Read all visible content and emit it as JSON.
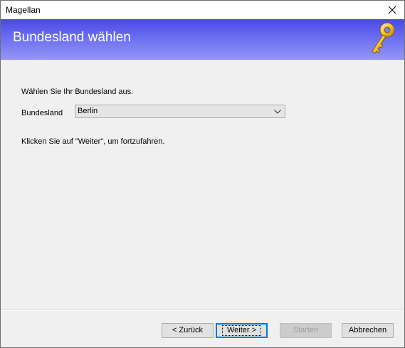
{
  "window": {
    "title": "Magellan"
  },
  "banner": {
    "heading": "Bundesland wählen",
    "icon": "key-icon"
  },
  "content": {
    "intro": "Wählen Sie Ihr Bundesland aus.",
    "field_label": "Bundesland",
    "selected_state": "Berlin",
    "hint": "Klicken Sie auf \"Weiter\", um fortzufahren."
  },
  "buttons": {
    "back": "< Zurück",
    "next": "Weiter >",
    "start": "Starten",
    "cancel": "Abbrechen"
  },
  "colors": {
    "banner_top": "#4848e6",
    "banner_bottom": "#9496f3",
    "focus_border": "#0078d7"
  }
}
